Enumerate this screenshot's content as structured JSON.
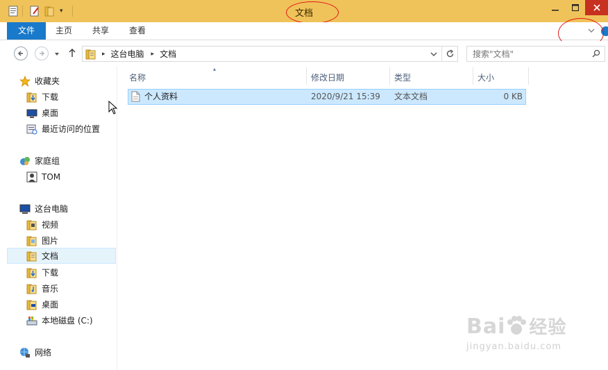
{
  "window": {
    "title": "文档",
    "minimize_icon": "minimize-icon",
    "maximize_icon": "maximize-icon",
    "close_icon": "close-icon",
    "close_color": "#c7311f",
    "titlebar_color": "#f0c35a"
  },
  "ribbon": {
    "tabs": [
      "文件",
      "主页",
      "共享",
      "查看"
    ],
    "file_tab_color": "#1979ca"
  },
  "address": {
    "path": [
      "这台电脑",
      "文档"
    ],
    "search_placeholder": "搜索\"文档\""
  },
  "sidebar": {
    "favorites": {
      "label": "收藏夹",
      "items": [
        "下载",
        "桌面",
        "最近访问的位置"
      ]
    },
    "homegroup": {
      "label": "家庭组",
      "items": [
        "TOM"
      ]
    },
    "this_pc": {
      "label": "这台电脑",
      "items": [
        "视频",
        "图片",
        "文档",
        "下载",
        "音乐",
        "桌面",
        "本地磁盘 (C:)"
      ]
    },
    "network": {
      "label": "网络"
    }
  },
  "columns": [
    "名称",
    "修改日期",
    "类型",
    "大小"
  ],
  "files": [
    {
      "name": "个人资料",
      "modified": "2020/9/21 15:39",
      "type": "文本文档",
      "size": "0 KB"
    }
  ],
  "watermark": {
    "brand": "Bai",
    "brand_tail": "经验",
    "url": "jingyan.baidu.com"
  }
}
